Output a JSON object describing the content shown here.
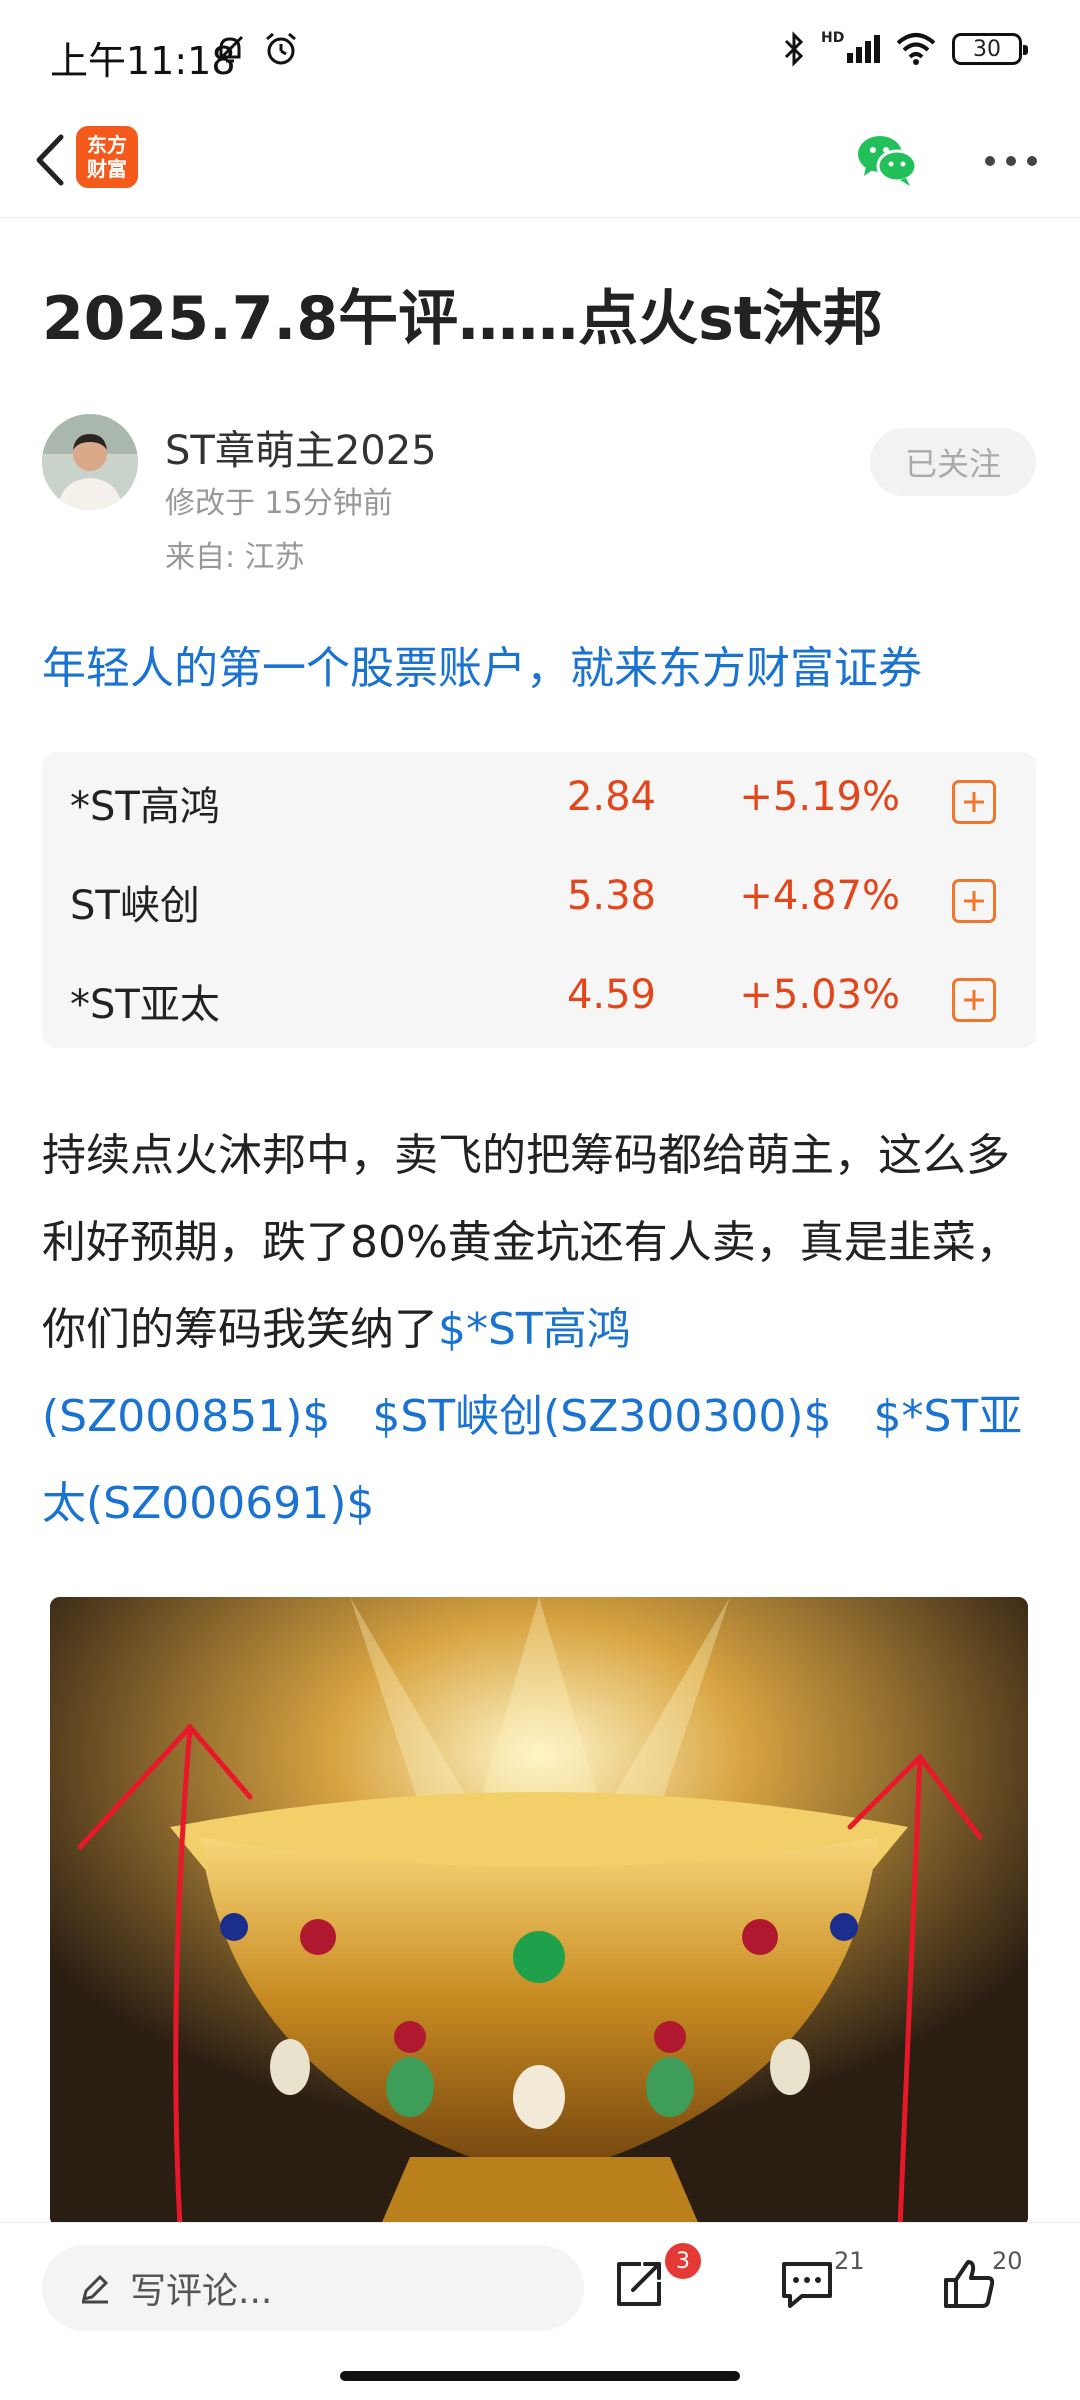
{
  "status_bar": {
    "time": "上午11:18",
    "hd_label": "HD",
    "battery": "30"
  },
  "app_bar": {
    "logo_text": "东方财富"
  },
  "article": {
    "title": "2025.7.8午评……点火st沐邦",
    "author": "ST章萌主2025",
    "modified": "修改于 15分钟前",
    "location": "来自: 江苏",
    "follow_label": "已关注",
    "promo": "年轻人的第一个股票账户，就来东方财富证券",
    "stocks": [
      {
        "name": "*ST高鸿",
        "price": "2.84",
        "change": "+5.19%"
      },
      {
        "name": "ST峡创",
        "price": "5.38",
        "change": "+4.87%"
      },
      {
        "name": "*ST亚太",
        "price": "4.59",
        "change": "+5.03%"
      }
    ],
    "body_text": "持续点火沐邦中，卖飞的把筹码都给萌主，这么多利好预期，跌了80%黄金坑还有人卖，真是韭菜，你们的筹码我笑纳了",
    "links": [
      "$*ST高鸿(SZ000851)$",
      "$ST峡创(SZ300300)$",
      "$*ST亚太(SZ000691)$"
    ]
  },
  "bottom_bar": {
    "comment_placeholder": "写评论...",
    "share_badge": "3",
    "comment_count": "21",
    "like_count": "20"
  },
  "colors": {
    "link_blue": "#1a73d1",
    "price_red": "#e2461a",
    "brand_orange": "#f35a1c"
  }
}
